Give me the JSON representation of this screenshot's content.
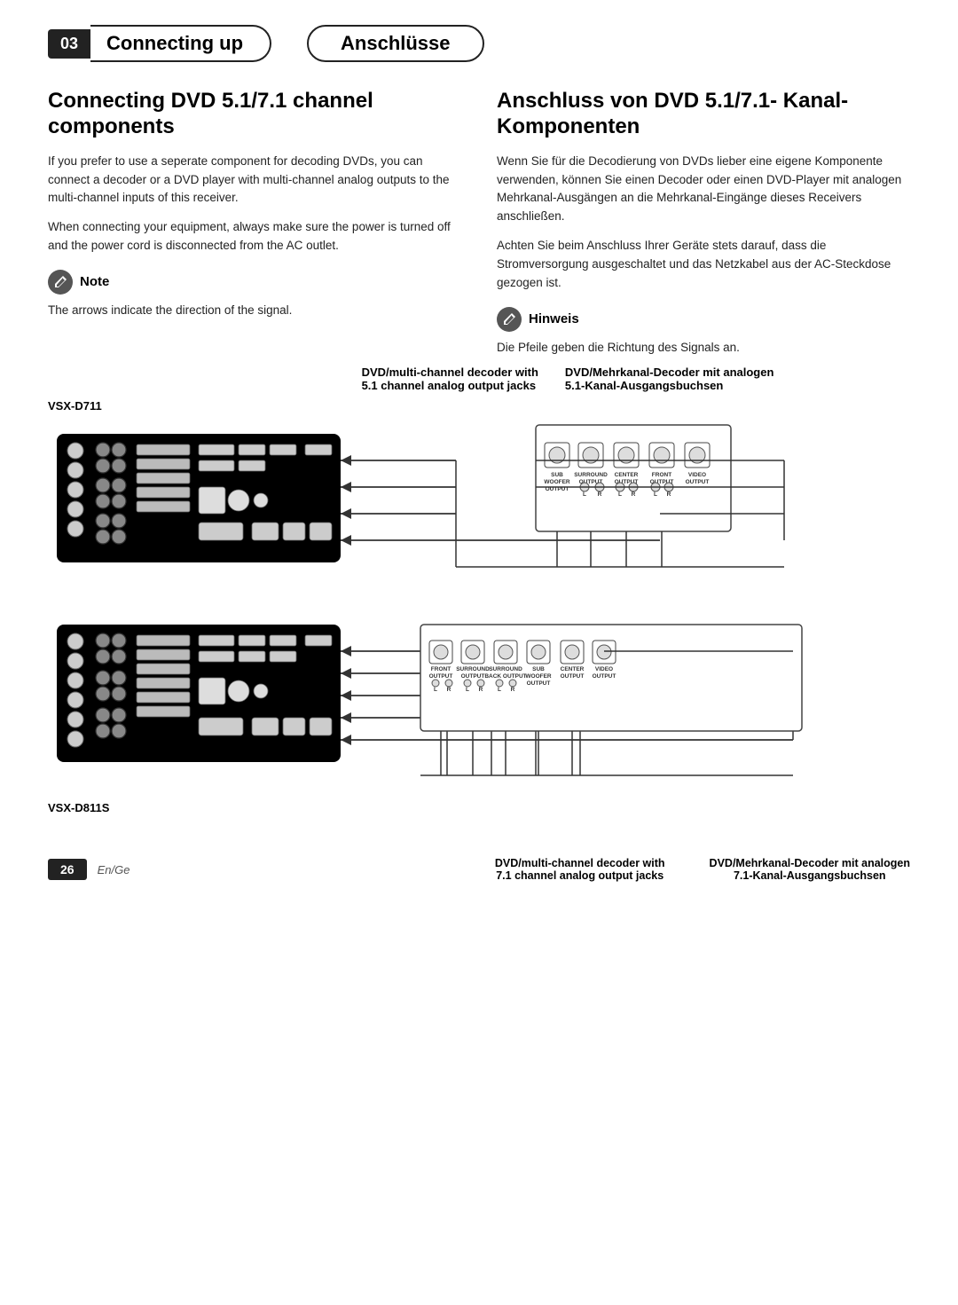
{
  "header": {
    "chapter": "03",
    "title_en": "Connecting up",
    "title_de": "Anschlüsse"
  },
  "section_en": {
    "title": "Connecting DVD 5.1/7.1 channel components",
    "para1": "If you prefer to use a seperate component for decoding DVDs, you can connect a decoder or a DVD player with multi-channel analog outputs to the multi-channel inputs of this receiver.",
    "para2": "When connecting your equipment, always make sure the power is turned off and the power cord is disconnected from the AC outlet.",
    "note_label": "Note",
    "note_text": "The arrows indicate the direction of the signal."
  },
  "section_de": {
    "title": "Anschluss von DVD 5.1/7.1- Kanal-Komponenten",
    "para1": "Wenn Sie für die Decodierung von DVDs lieber eine eigene Komponente verwenden, können Sie einen Decoder oder einen DVD-Player mit analogen Mehrkanal-Ausgängen an die Mehrkanal-Eingänge dieses Receivers anschließen.",
    "para2": "Achten Sie beim Anschluss Ihrer Geräte stets darauf, dass die Stromversorgung ausgeschaltet und das Netzkabel aus der AC-Steckdose gezogen ist.",
    "note_label": "Hinweis",
    "note_text": "Die Pfeile geben die Richtung des Signals an."
  },
  "diagram": {
    "caption_top_en": "DVD/multi-channel decoder with",
    "caption_top_en2": "DVD/Mehrkanal-Decoder mit analogen",
    "caption_top_en3": "5.1 channel analog output jacks",
    "caption_top_de3": "5.1-Kanal-Ausgangsbuchsen",
    "receiver1_label": "VSX-D711",
    "receiver2_label": "VSX-D811S",
    "caption_bottom_en": "DVD/multi-channel decoder with",
    "caption_bottom_de": "DVD/Mehrkanal-Decoder mit analogen",
    "caption_bottom_en2": "7.1 channel analog output jacks",
    "caption_bottom_de2": "7.1-Kanal-Ausgangsbuchsen"
  },
  "footer": {
    "page_number": "26",
    "lang": "En/Ge"
  }
}
